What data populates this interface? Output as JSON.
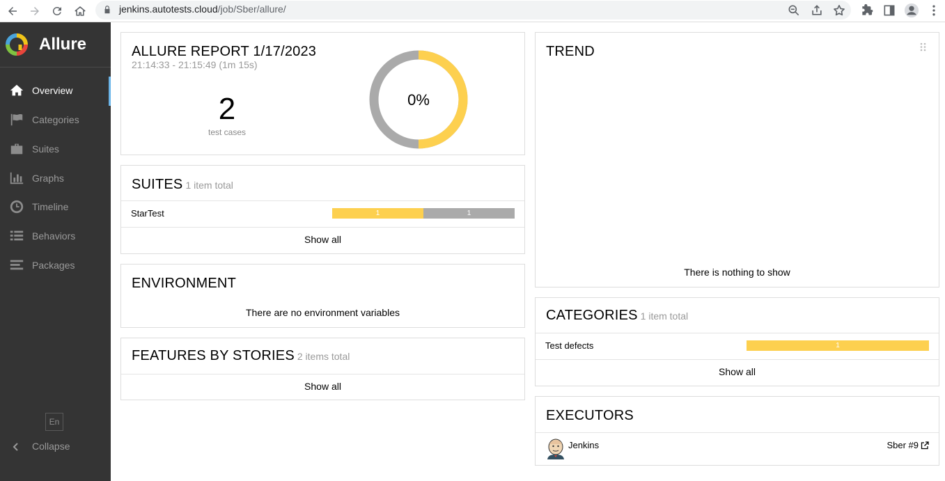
{
  "browser": {
    "url_host": "jenkins.autotests.cloud",
    "url_path": "/job/Sber/allure/"
  },
  "sidebar": {
    "brand": "Allure",
    "items": [
      {
        "label": "Overview",
        "icon": "home-icon",
        "active": true
      },
      {
        "label": "Categories",
        "icon": "flag-icon"
      },
      {
        "label": "Suites",
        "icon": "briefcase-icon"
      },
      {
        "label": "Graphs",
        "icon": "bar-chart-icon"
      },
      {
        "label": "Timeline",
        "icon": "clock-icon"
      },
      {
        "label": "Behaviors",
        "icon": "list-icon"
      },
      {
        "label": "Packages",
        "icon": "align-left-icon"
      }
    ],
    "language": "En",
    "collapse_label": "Collapse"
  },
  "summary": {
    "title": "ALLURE REPORT 1/17/2023",
    "time_range": "21:14:33 - 21:15:49 (1m 15s)",
    "test_count": "2",
    "test_count_label": "test cases",
    "percent": "0%",
    "donut": {
      "passed_fraction": 0.0,
      "failed_fraction": 0.5,
      "broken_fraction": 0.5,
      "colors": {
        "failed": "#aaaaaa",
        "broken": "#fdd04f"
      }
    }
  },
  "suites": {
    "title": "SUITES",
    "total": "1 item total",
    "rows": [
      {
        "name": "StarTest",
        "segments": [
          {
            "value": "1",
            "color": "#fdd04f"
          },
          {
            "value": "1",
            "color": "#aaaaaa"
          }
        ]
      }
    ],
    "show_all": "Show all"
  },
  "environment": {
    "title": "ENVIRONMENT",
    "message": "There are no environment variables"
  },
  "features": {
    "title": "FEATURES BY STORIES",
    "total": "2 items total",
    "show_all": "Show all"
  },
  "trend": {
    "title": "TREND",
    "message": "There is nothing to show"
  },
  "categories": {
    "title": "CATEGORIES",
    "total": "1 item total",
    "rows": [
      {
        "name": "Test defects",
        "value": "1",
        "color": "#fdd04f"
      }
    ],
    "show_all": "Show all"
  },
  "executors": {
    "title": "EXECUTORS",
    "name": "Jenkins",
    "build": "Sber #9"
  }
}
